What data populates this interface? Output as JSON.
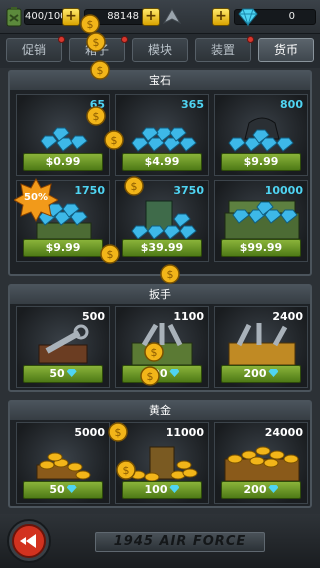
{
  "status": {
    "fuel": "400/100",
    "coins": "88148",
    "gems": "0"
  },
  "tabs": [
    {
      "label": "促销",
      "active": false,
      "dot": true
    },
    {
      "label": "箱子",
      "active": false,
      "dot": true
    },
    {
      "label": "模块",
      "active": false,
      "dot": false
    },
    {
      "label": "装置",
      "active": false,
      "dot": true
    },
    {
      "label": "货币",
      "active": true,
      "dot": false
    }
  ],
  "sections": {
    "gems": {
      "title": "宝石",
      "items": [
        {
          "amount": "65",
          "price": "$0.99"
        },
        {
          "amount": "365",
          "price": "$4.99"
        },
        {
          "amount": "800",
          "price": "$9.99"
        },
        {
          "amount": "1750",
          "price": "$9.99"
        },
        {
          "amount": "3750",
          "price": "$39.99"
        },
        {
          "amount": "10000",
          "price": "$99.99"
        }
      ],
      "discount_badge": "50%"
    },
    "wrench": {
      "title": "扳手",
      "items": [
        {
          "amount": "500",
          "price": "50"
        },
        {
          "amount": "1100",
          "price": "100"
        },
        {
          "amount": "2400",
          "price": "200"
        }
      ]
    },
    "gold": {
      "title": "黄金",
      "items": [
        {
          "amount": "5000",
          "price": "50"
        },
        {
          "amount": "11000",
          "price": "100"
        },
        {
          "amount": "24000",
          "price": "200"
        }
      ]
    }
  },
  "footer": {
    "title": "1945 AIR FORCE"
  },
  "colors": {
    "accent_gem": "#4fd4f2",
    "button_green": "#6e9a2a",
    "coin_gold": "#f2b519",
    "back_red": "#d2321f"
  },
  "icons": [
    "fuel-icon",
    "coin-icon",
    "wing-icon",
    "gem-icon",
    "plus-icon",
    "back-arrow-icon"
  ]
}
